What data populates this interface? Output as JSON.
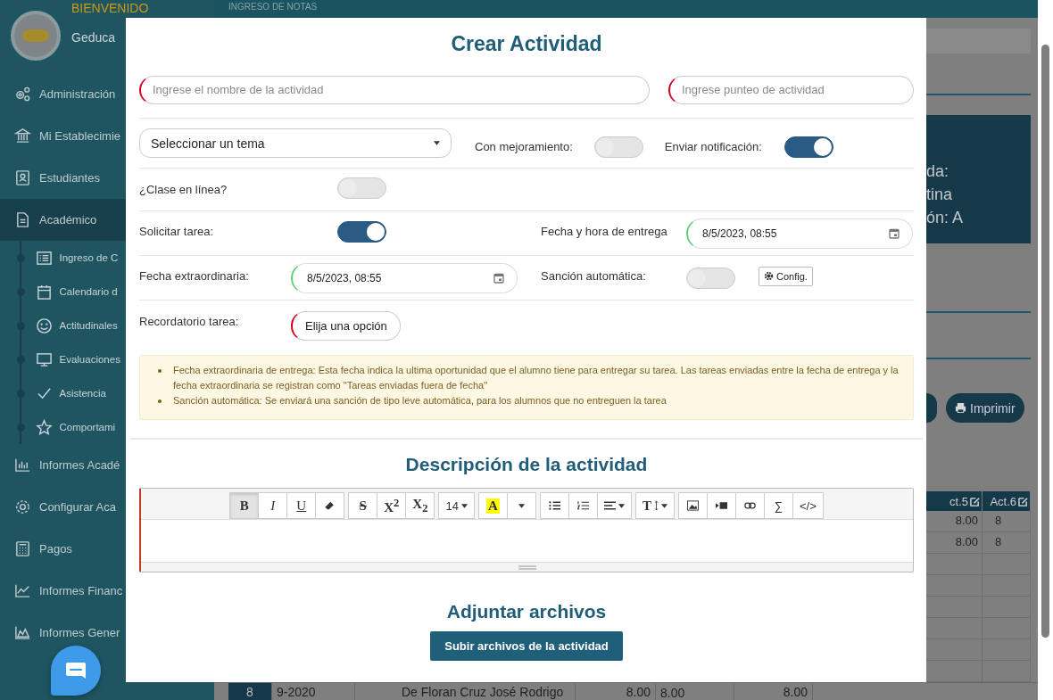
{
  "sidebar": {
    "welcome": "BIENVENIDO",
    "user": "Geduca",
    "items": [
      {
        "label": "Administración",
        "selected": false
      },
      {
        "label": "Mi Establecimie",
        "selected": false
      },
      {
        "label": "Estudiantes",
        "selected": false
      },
      {
        "label": "Académico",
        "selected": true,
        "children": [
          {
            "label": "Ingreso de C"
          },
          {
            "label": "Calendario d"
          },
          {
            "label": "Actitudinales"
          },
          {
            "label": "Evaluaciones"
          },
          {
            "label": "Asistencia"
          },
          {
            "label": "Comportami"
          }
        ]
      },
      {
        "label": "Informes Acadé",
        "selected": false
      },
      {
        "label": "Configurar Aca",
        "selected": false
      },
      {
        "label": "Pagos",
        "selected": false
      },
      {
        "label": "Informes Financ",
        "selected": false
      },
      {
        "label": "Informes Gener",
        "selected": false
      }
    ]
  },
  "header": {
    "title": "INGRESO DE NOTAS"
  },
  "background": {
    "info_lines": [
      "da:",
      "tina",
      "ón: A"
    ],
    "print_button": "Imprimir",
    "columns": [
      "ct.5",
      "Act.6"
    ],
    "rows": [
      [
        "8.00",
        "8"
      ],
      [
        "8.00",
        "8"
      ]
    ],
    "bottom_row": [
      "8",
      "9-2020",
      "De Floran Cruz José Rodrigo",
      "8.00",
      "8.00",
      "8.00"
    ]
  },
  "modal": {
    "title": "Crear Actividad",
    "name_field": {
      "placeholder": "Ingrese el nombre de la actividad"
    },
    "score_field": {
      "placeholder": "Ingrese punteo de actividad"
    },
    "topic_select": {
      "value": "Seleccionar un tema"
    },
    "improvement": {
      "label": "Con mejoramiento:",
      "on": false
    },
    "notify": {
      "label": "Enviar notificación:",
      "on": true
    },
    "online_class": {
      "label": "¿Clase en línea?",
      "on": false
    },
    "request_task": {
      "label": "Solicitar tarea:",
      "on": true
    },
    "due_date": {
      "label": "Fecha y hora de entrega",
      "value": "8/5/2023, 08:55"
    },
    "extra_date": {
      "label": "Fecha extraordinaria:",
      "value": "8/5/2023, 08:55"
    },
    "auto_sanction": {
      "label": "Sanción automática:",
      "on": false,
      "config_button": "Config."
    },
    "reminder": {
      "label": "Recordatorio tarea:",
      "value": "Elija una opción"
    },
    "notes": [
      "Fecha extraordinaria de entrega: Esta fecha indica la ultima oportunidad que el alumno tiene para entregar su tarea. Las tareas enviadas entre la fecha de entrega y la fecha extraordinaria se registran como \"Tareas enviadas fuera de fecha\"",
      "Sanción automática: Se enviará una sanción de tipo leve automática, para los alumnos que no entreguen la tarea"
    ],
    "description_title": "Descripción de la actividad",
    "toolbar": [
      [
        {
          "kind": "bold",
          "label": "B",
          "active": true
        },
        {
          "kind": "italic",
          "label": "I",
          "active": false
        },
        {
          "kind": "underline",
          "label": "U",
          "active": false
        },
        {
          "kind": "eraser",
          "active": false
        }
      ],
      [
        {
          "kind": "strike",
          "label": "S",
          "active": false
        },
        {
          "kind": "sup",
          "label": "X$^{2}$",
          "active": false
        },
        {
          "kind": "sub",
          "label": "X$_{2}$",
          "active": false
        }
      ],
      [
        {
          "kind": "size",
          "label": "14",
          "active": false
        }
      ],
      [
        {
          "kind": "color",
          "label": "A",
          "active": false
        },
        {
          "kind": "caret",
          "active": false
        }
      ],
      [
        {
          "kind": "ul",
          "active": false
        },
        {
          "kind": "ol",
          "active": false
        },
        {
          "kind": "align",
          "active": false
        }
      ],
      [
        {
          "kind": "height",
          "label": "T",
          "active": false
        }
      ],
      [
        {
          "kind": "image",
          "active": false
        },
        {
          "kind": "video",
          "active": false
        },
        {
          "kind": "link",
          "active": false
        },
        {
          "kind": "sum",
          "label": "∑",
          "active": false
        },
        {
          "kind": "code",
          "label": "</>",
          "active": false
        }
      ]
    ],
    "attach_title": "Adjuntar archivos",
    "upload_button": "Subir archivos de la actividad"
  }
}
